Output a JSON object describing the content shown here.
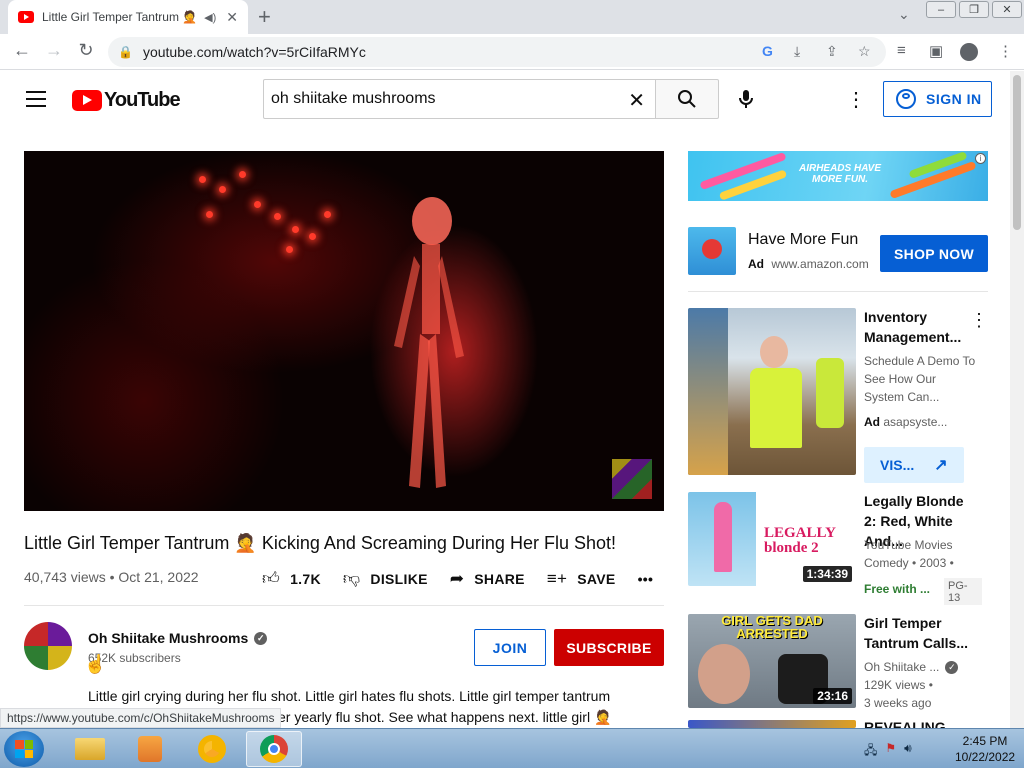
{
  "browser": {
    "tab_title": "Little Girl Temper Tantrum 🤦",
    "url": "youtube.com/watch?v=5rCiIfaRMYc"
  },
  "header": {
    "logo_text": "YouTube",
    "search_value": "oh shiitake mushrooms",
    "sign_in_label": "SIGN IN"
  },
  "video": {
    "title": "Little Girl Temper Tantrum 🤦 Kicking And Screaming During Her Flu Shot!",
    "views_date": "40,743 views • Oct 21, 2022",
    "like_count": "1.7K",
    "dislike_label": "DISLIKE",
    "share_label": "SHARE",
    "save_label": "SAVE"
  },
  "channel": {
    "name": "Oh Shiitake Mushrooms",
    "subscribers": "652K subscribers",
    "join_label": "JOIN",
    "subscribe_label": "SUBSCRIBE",
    "description_line1": "Little girl crying during her flu shot. Little girl hates flu shots. Little girl temper tantrum",
    "description_line2": "er yearly flu shot. See what happens next. little girl 🤦"
  },
  "status_url": "https://www.youtube.com/c/OhShiitakeMushrooms",
  "sidebar": {
    "banner_text": "AIRHEADS HAVE MORE FUN.",
    "ad": {
      "headline": "Have More Fun",
      "ad_label": "Ad",
      "domain": "www.amazon.com",
      "cta": "SHOP NOW"
    },
    "items": [
      {
        "title": "Inventory Management...",
        "desc": "Schedule A Demo To See How Our System Can...",
        "ad_label": "Ad",
        "advertiser": "asapsyste...",
        "cta": "VIS..."
      },
      {
        "title": "Legally Blonde 2: Red, White And...",
        "channel": "YouTube Movies",
        "meta": "Comedy • 2003 •",
        "duration": "1:34:39",
        "badge": "Free with ...",
        "rating": "PG-13",
        "thumb_text": "LEGALLY blonde 2"
      },
      {
        "title": "Girl Temper Tantrum Calls...",
        "channel": "Oh Shiitake ...",
        "views": "129K views •",
        "age": "3 weeks ago",
        "duration": "23:16",
        "thumb_text": "GIRL GETS DAD ARRESTED"
      },
      {
        "title": "REVEALING MY..."
      }
    ]
  },
  "taskbar": {
    "time": "2:45 PM",
    "date": "10/22/2022"
  }
}
